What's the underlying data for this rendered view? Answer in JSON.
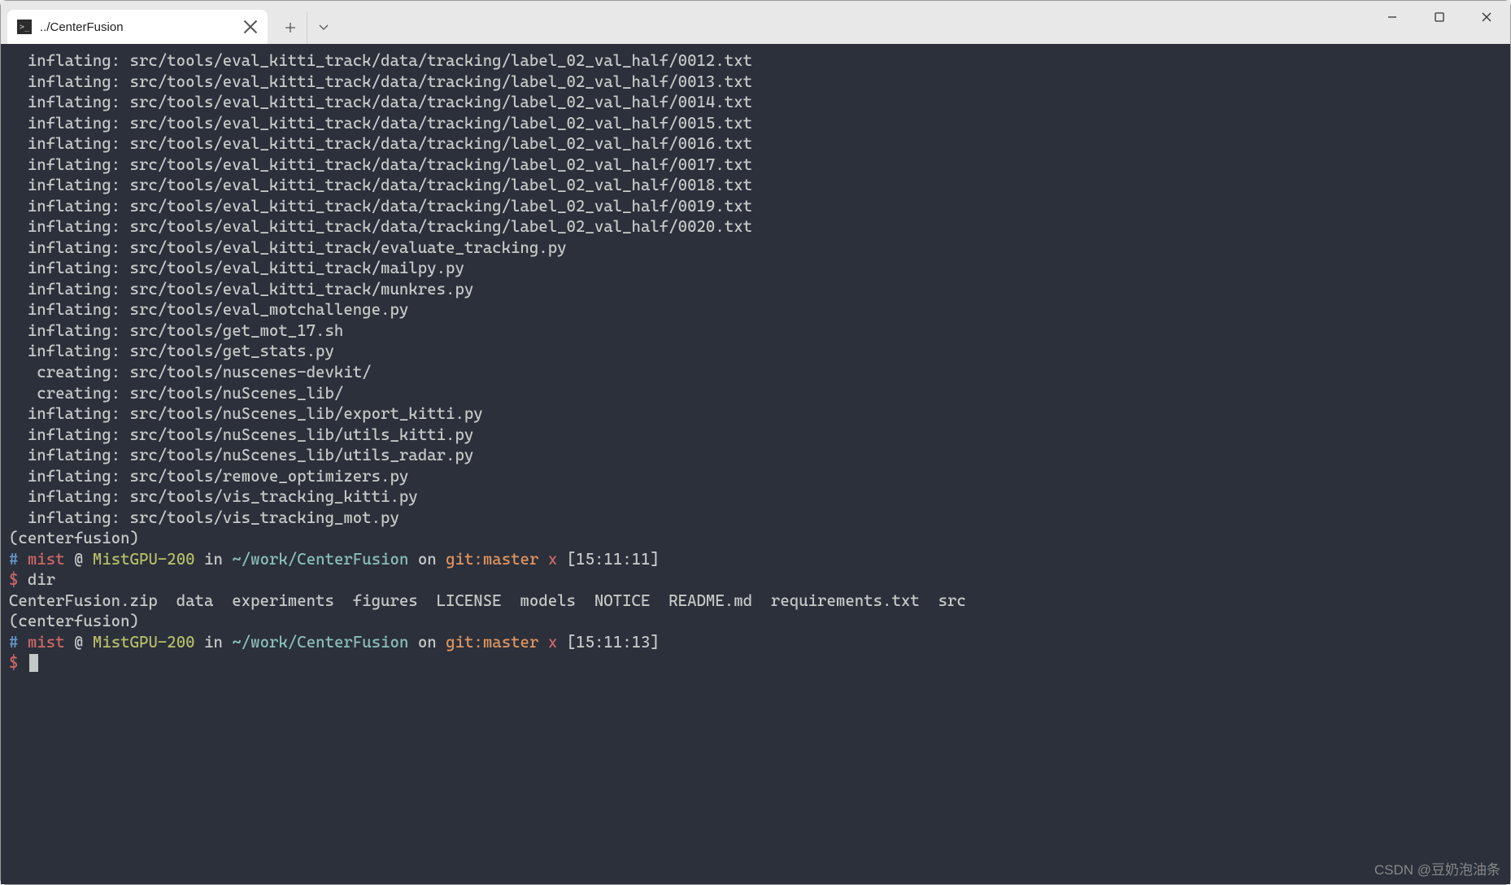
{
  "tab": {
    "title": "../CenterFusion",
    "icon_glyph": ">_"
  },
  "output_lines": [
    "  inflating: src/tools/eval_kitti_track/data/tracking/label_02_val_half/0012.txt",
    "  inflating: src/tools/eval_kitti_track/data/tracking/label_02_val_half/0013.txt",
    "  inflating: src/tools/eval_kitti_track/data/tracking/label_02_val_half/0014.txt",
    "  inflating: src/tools/eval_kitti_track/data/tracking/label_02_val_half/0015.txt",
    "  inflating: src/tools/eval_kitti_track/data/tracking/label_02_val_half/0016.txt",
    "  inflating: src/tools/eval_kitti_track/data/tracking/label_02_val_half/0017.txt",
    "  inflating: src/tools/eval_kitti_track/data/tracking/label_02_val_half/0018.txt",
    "  inflating: src/tools/eval_kitti_track/data/tracking/label_02_val_half/0019.txt",
    "  inflating: src/tools/eval_kitti_track/data/tracking/label_02_val_half/0020.txt",
    "  inflating: src/tools/eval_kitti_track/evaluate_tracking.py",
    "  inflating: src/tools/eval_kitti_track/mailpy.py",
    "  inflating: src/tools/eval_kitti_track/munkres.py",
    "  inflating: src/tools/eval_motchallenge.py",
    "  inflating: src/tools/get_mot_17.sh",
    "  inflating: src/tools/get_stats.py",
    "   creating: src/tools/nuscenes-devkit/",
    "   creating: src/tools/nuScenes_lib/",
    "  inflating: src/tools/nuScenes_lib/export_kitti.py",
    "  inflating: src/tools/nuScenes_lib/utils_kitti.py",
    "  inflating: src/tools/nuScenes_lib/utils_radar.py",
    "  inflating: src/tools/remove_optimizers.py",
    "  inflating: src/tools/vis_tracking_kitti.py",
    "  inflating: src/tools/vis_tracking_mot.py"
  ],
  "env_name": "(centerfusion)",
  "prompt1": {
    "hash": "#",
    "user": "mist",
    "at": "@",
    "host": "MistGPU-200",
    "in": "in",
    "path": "~/work/CenterFusion",
    "on": "on",
    "git": "git:master",
    "x": "x",
    "time": "[15:11:11]"
  },
  "prompt2": {
    "hash": "#",
    "user": "mist",
    "at": "@",
    "host": "MistGPU-200",
    "in": "in",
    "path": "~/work/CenterFusion",
    "on": "on",
    "git": "git:master",
    "x": "x",
    "time": "[15:11:13]"
  },
  "dollar": "$",
  "cmd1": "dir",
  "dir_output": "CenterFusion.zip  data  experiments  figures  LICENSE  models  NOTICE  README.md  requirements.txt  src",
  "watermark": "CSDN @豆奶泡油条"
}
